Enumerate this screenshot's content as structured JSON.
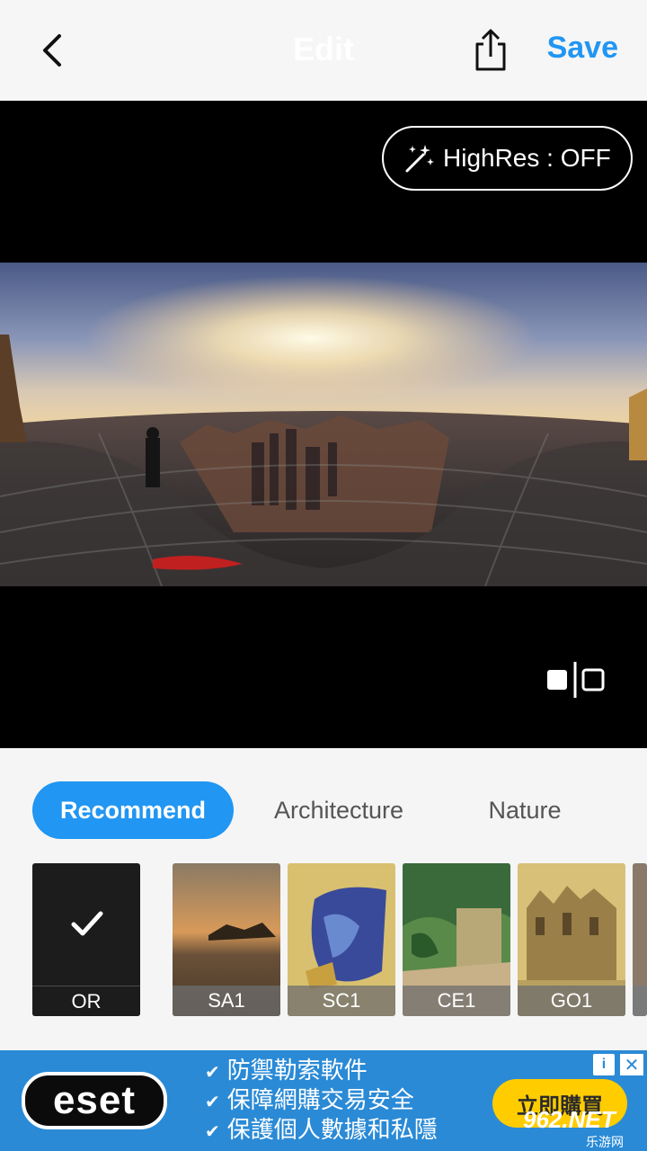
{
  "header": {
    "title": "Edit",
    "save_label": "Save",
    "back_icon": "chevron-left-icon",
    "share_icon": "share-icon"
  },
  "preview": {
    "highres_label": "HighRes : OFF",
    "highres_icon": "magic-wand-icon",
    "compare_icon": "compare-split-icon"
  },
  "tabs": [
    {
      "label": "Recommend",
      "active": true
    },
    {
      "label": "Architecture",
      "active": false
    },
    {
      "label": "Nature",
      "active": false
    }
  ],
  "filters": [
    {
      "label": "OR",
      "selected": true
    },
    {
      "label": "SA1",
      "selected": false
    },
    {
      "label": "SC1",
      "selected": false
    },
    {
      "label": "CE1",
      "selected": false
    },
    {
      "label": "GO1",
      "selected": false
    }
  ],
  "ad": {
    "brand": "eset",
    "lines": [
      "防禦勒索軟件",
      "保障網購交易安全",
      "保護個人數據和私隱"
    ],
    "cta": "立即購買",
    "watermark": "962.NET",
    "watermark_sub": "乐游网"
  },
  "colors": {
    "accent": "#2196f3",
    "ad_bg": "#2a8ad6",
    "cta_bg": "#ffcc00"
  }
}
